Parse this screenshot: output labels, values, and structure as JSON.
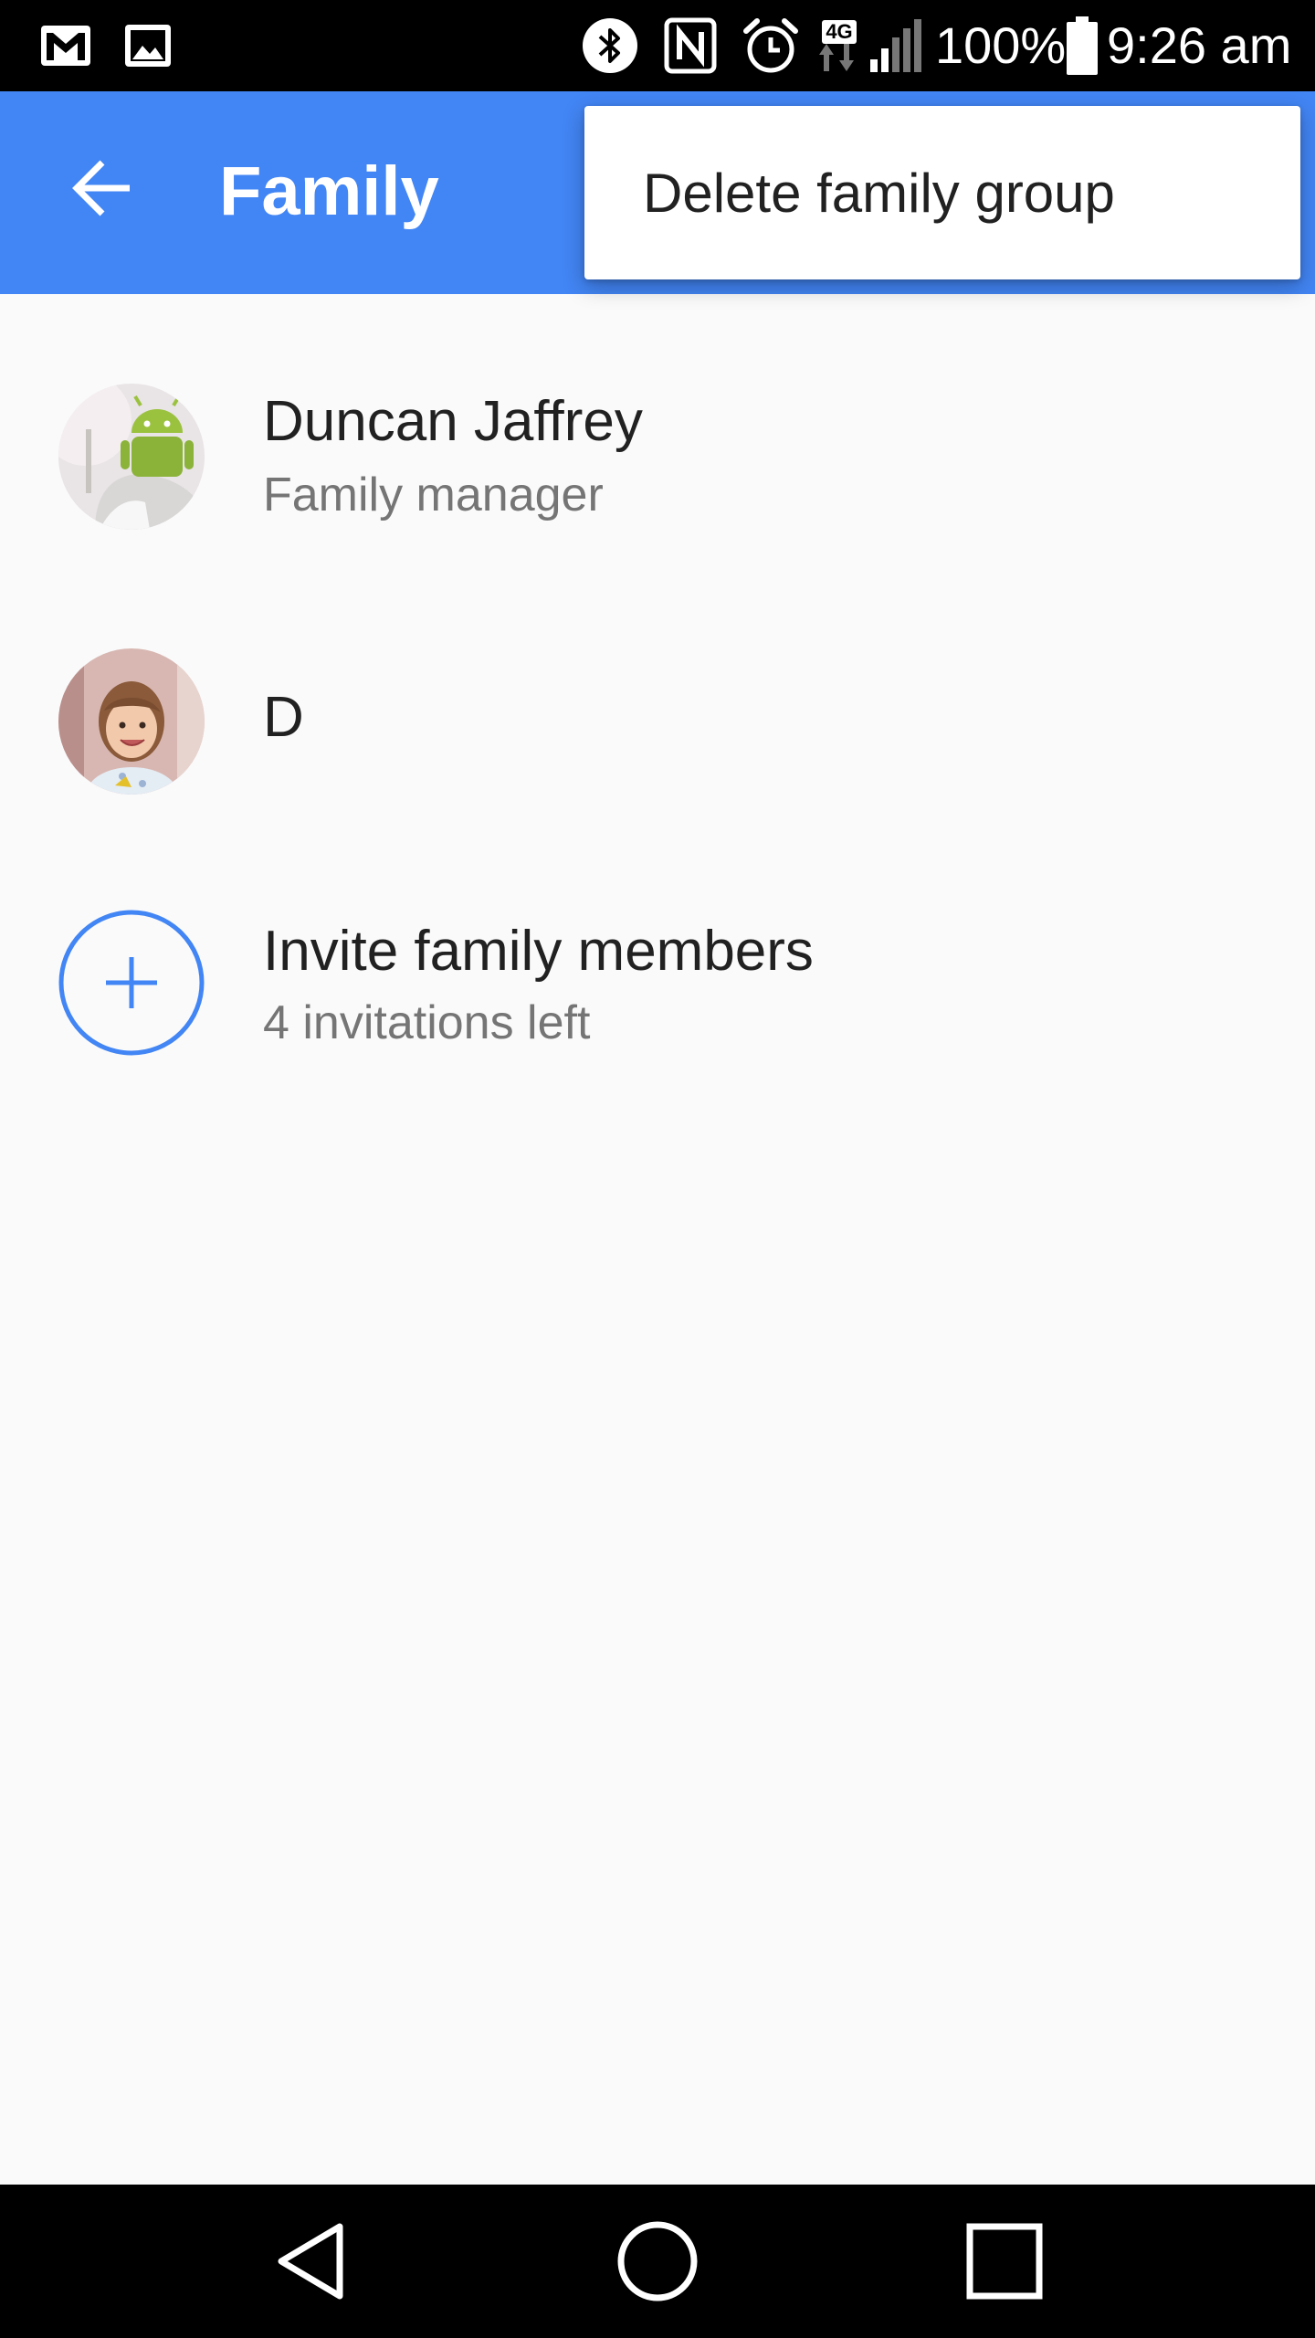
{
  "status_bar": {
    "battery_text": "100%",
    "time": "9:26 am",
    "network_badge": "4G",
    "icons": [
      "gmail-icon",
      "image-icon",
      "bluetooth-icon",
      "nfc-icon",
      "alarm-icon",
      "network-4g-icon",
      "signal-icon",
      "battery-icon"
    ]
  },
  "app_bar": {
    "title": "Family",
    "back_icon": "arrow-back-icon",
    "color": "#4285f4"
  },
  "overflow_menu": {
    "items": [
      {
        "label": "Delete family group"
      }
    ]
  },
  "members": [
    {
      "name": "Duncan Jaffrey",
      "role": "Family manager",
      "avatar": "android-robot-avatar"
    },
    {
      "name": "D",
      "role": "",
      "avatar": "child-photo-avatar"
    }
  ],
  "invite": {
    "label": "Invite family members",
    "sublabel": "4 invitations left",
    "icon": "add-circle-icon"
  },
  "nav_bar": {
    "icons": [
      "back-triangle-icon",
      "home-circle-icon",
      "recents-square-icon"
    ]
  }
}
